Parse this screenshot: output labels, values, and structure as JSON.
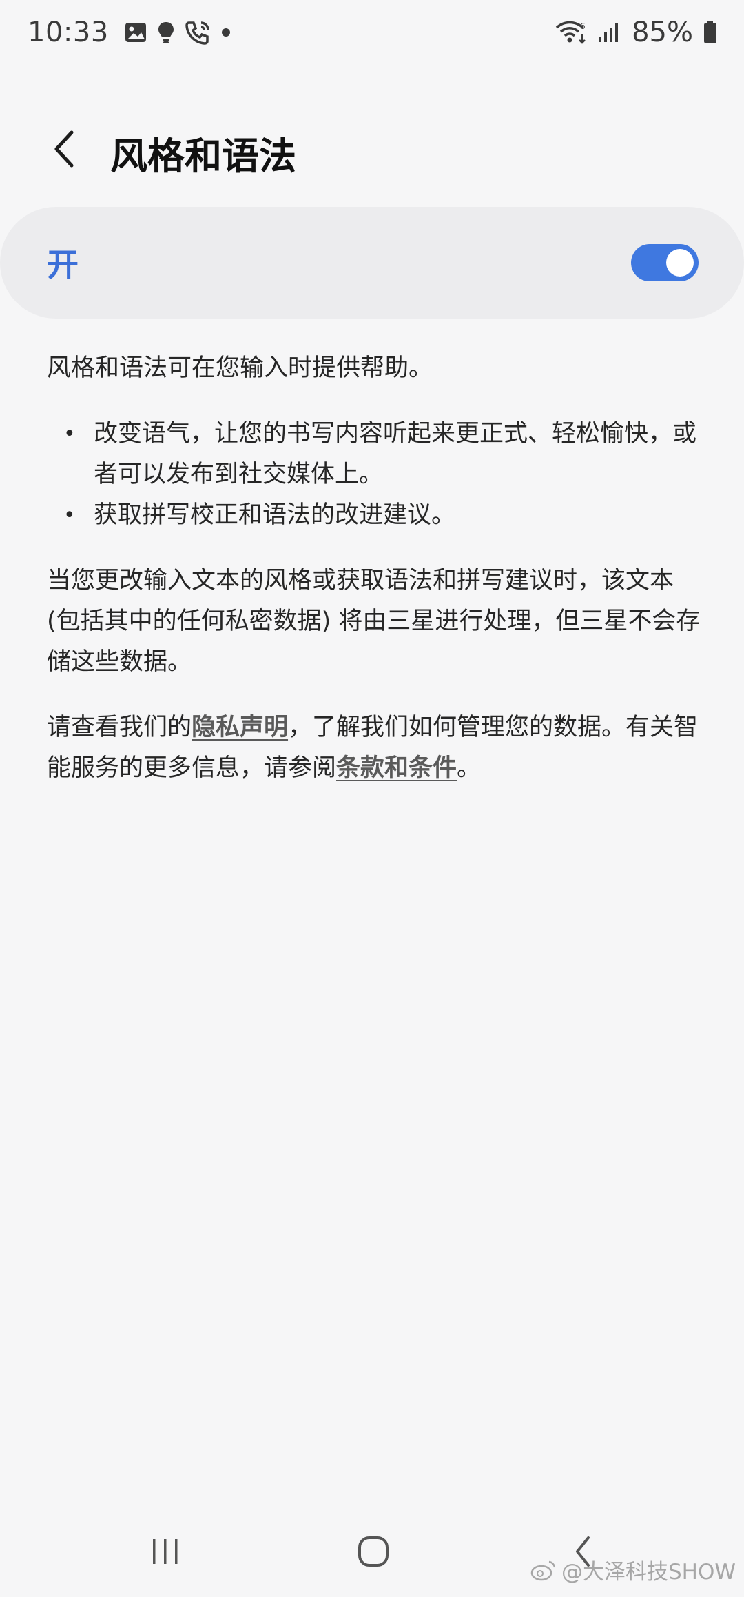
{
  "status_bar": {
    "time": "10:33",
    "battery": "85%",
    "icons": [
      "gallery-icon",
      "bulb-icon",
      "call-icon",
      "dot-icon",
      "wifi-icon",
      "signal-icon",
      "battery-icon"
    ]
  },
  "header": {
    "title": "风格和语法"
  },
  "master_switch": {
    "label": "开",
    "on": true,
    "accent": "#3f78e0"
  },
  "description": {
    "intro": "风格和语法可在您输入时提供帮助。",
    "bullets": [
      "改变语气，让您的书写内容听起来更正式、轻松愉快，或者可以发布到社交媒体上。",
      "获取拼写校正和语法的改进建议。"
    ],
    "processing_note": "当您更改输入文本的风格或获取语法和拼写建议时，该文本 (包括其中的任何私密数据) 将由三星进行处理，但三星不会存储这些数据。",
    "privacy_prefix": "请查看我们的",
    "privacy_link": "隐私声明",
    "privacy_middle": "，了解我们如何管理您的数据。有关智能服务的更多信息，请参阅",
    "terms_link": "条款和条件",
    "privacy_suffix": "。"
  },
  "watermark": {
    "text": "@大泽科技SHOW"
  }
}
